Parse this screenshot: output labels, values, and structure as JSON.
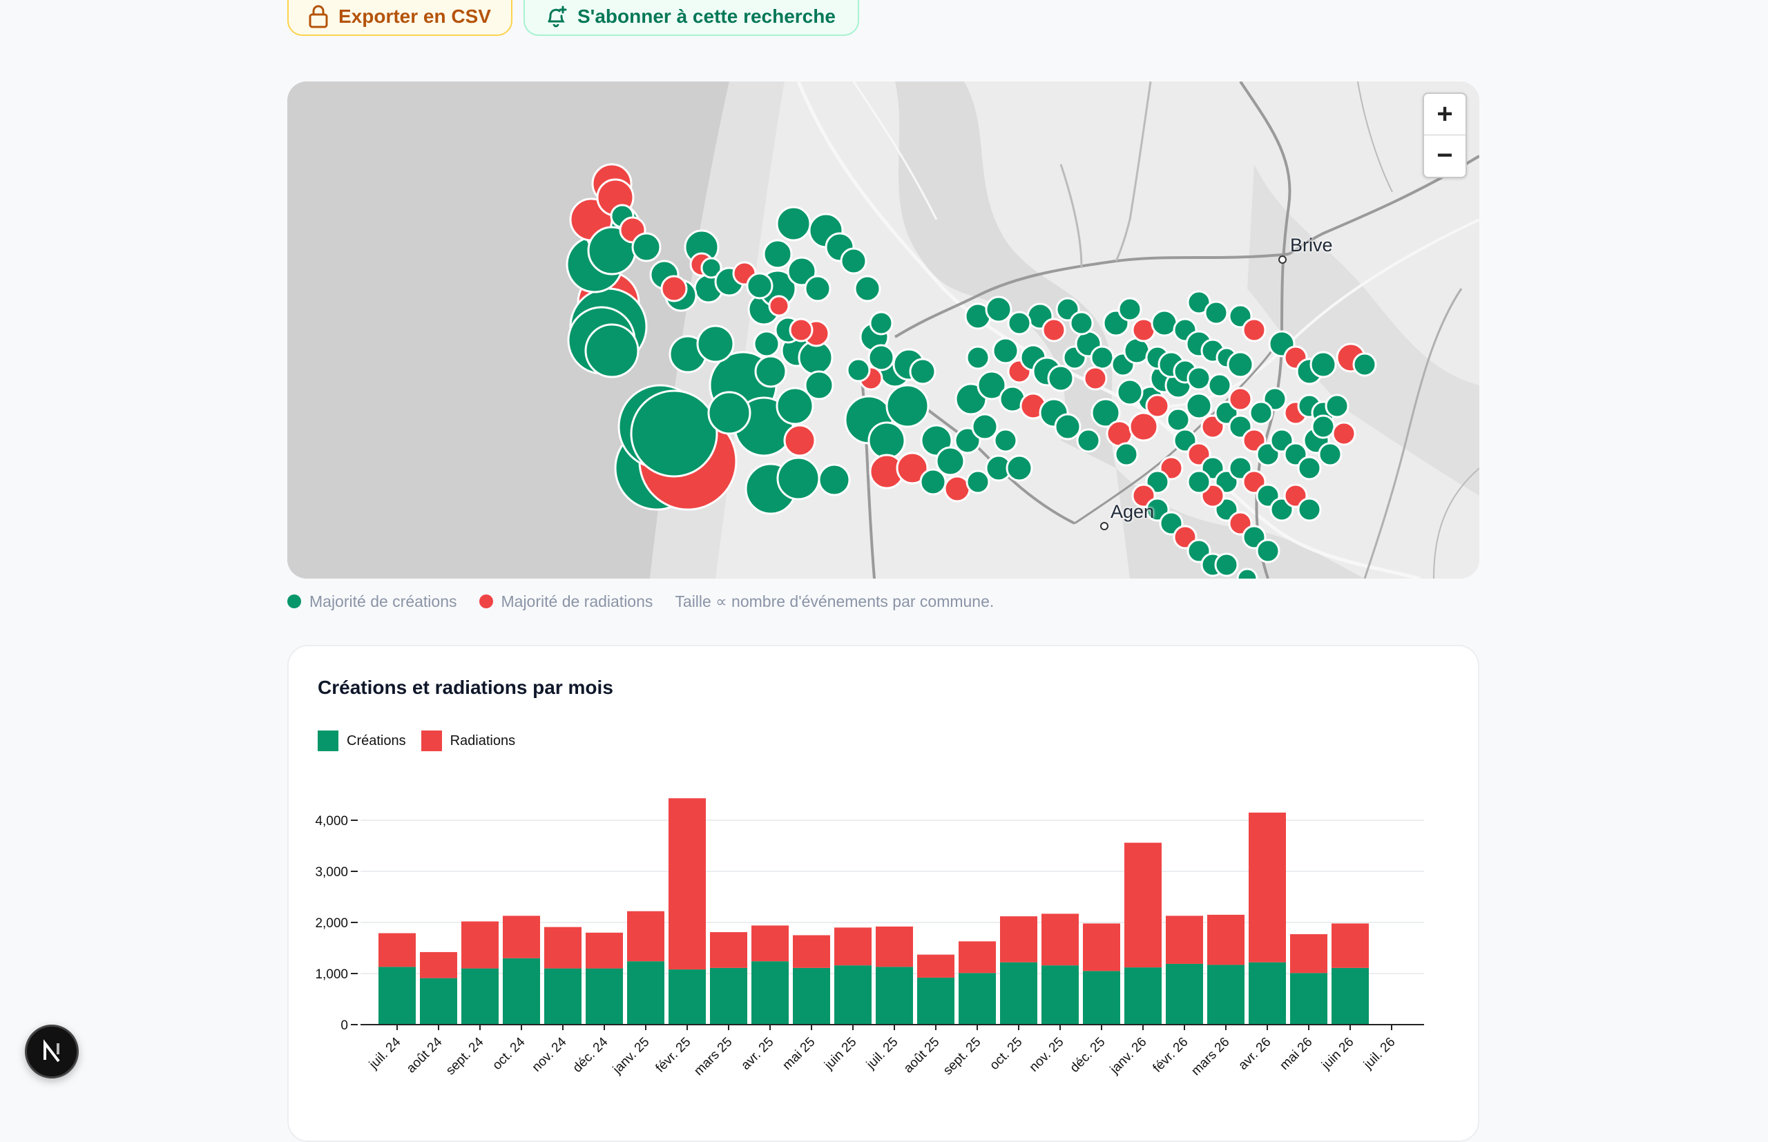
{
  "actions": {
    "export_label": "Exporter en CSV",
    "subscribe_label": "S'abonner à cette recherche"
  },
  "map": {
    "zoom_in": "+",
    "zoom_out": "−",
    "cities": [
      {
        "name": "Brive"
      },
      {
        "name": "Agen"
      }
    ],
    "legend": {
      "creations": "Majorité de créations",
      "radiations": "Majorité de radiations",
      "size_note": "Taille ∝ nombre d'événements par commune."
    },
    "colors": {
      "creations": "#079669",
      "radiations": "#ef4444"
    }
  },
  "chart_card": {
    "title": "Créations et radiations par mois"
  },
  "chart_data": {
    "type": "bar",
    "stacked": true,
    "categories": [
      "juil. 24",
      "août 24",
      "sept. 24",
      "oct. 24",
      "nov. 24",
      "déc. 24",
      "janv. 25",
      "févr. 25",
      "mars 25",
      "avr. 25",
      "mai 25",
      "juin 25",
      "juil. 25",
      "août 25",
      "sept. 25",
      "oct. 25",
      "nov. 25",
      "déc. 25",
      "janv. 26",
      "févr. 26",
      "mars 26",
      "avr. 26",
      "mai 26",
      "juin 26",
      "juil. 26"
    ],
    "series": [
      {
        "name": "Créations",
        "color": "#079669",
        "values": [
          1130,
          910,
          1100,
          1300,
          1100,
          1100,
          1240,
          1080,
          1110,
          1240,
          1110,
          1160,
          1130,
          920,
          1010,
          1220,
          1160,
          1050,
          1120,
          1190,
          1170,
          1220,
          1010,
          1110,
          0
        ]
      },
      {
        "name": "Radiations",
        "color": "#ef4444",
        "values": [
          660,
          510,
          920,
          830,
          810,
          700,
          980,
          3350,
          700,
          700,
          640,
          740,
          790,
          450,
          620,
          900,
          1010,
          930,
          2440,
          940,
          980,
          2930,
          760,
          870,
          0
        ]
      }
    ],
    "yticks": [
      "0",
      "1,000",
      "2,000",
      "3,000",
      "4,000"
    ],
    "ylim": [
      0,
      4500
    ],
    "grid": true,
    "legend_position": "top-left"
  }
}
